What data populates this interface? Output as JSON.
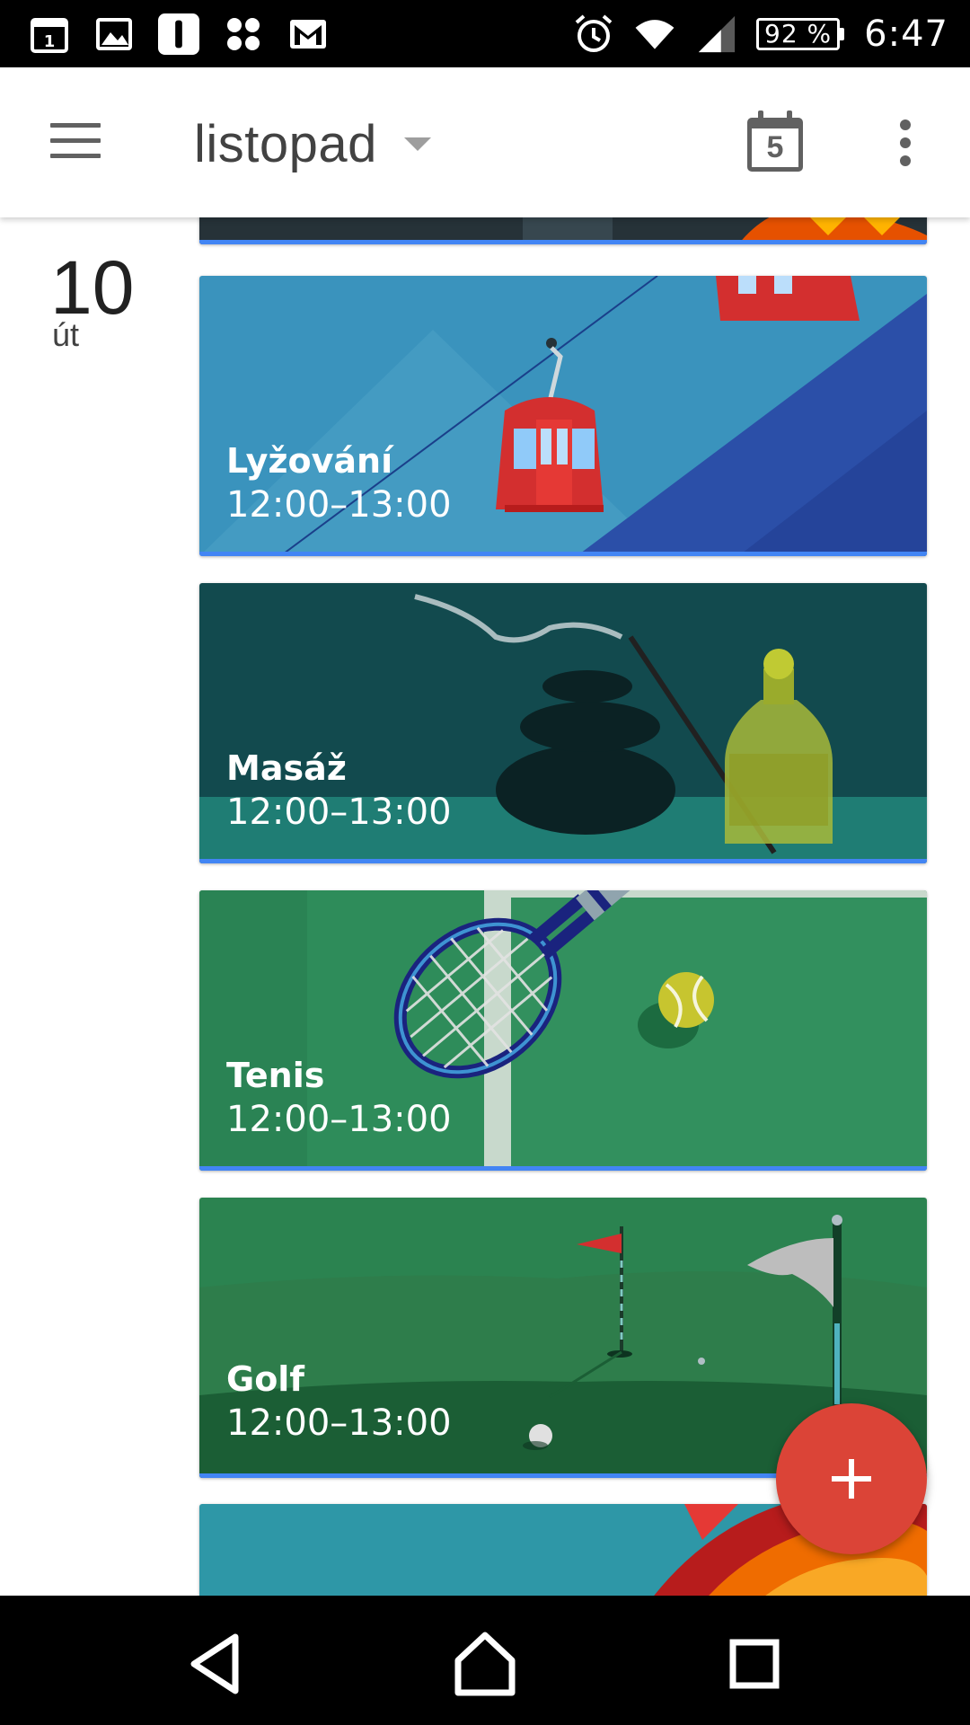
{
  "status_bar": {
    "left_icons": [
      "calendar-notification-icon",
      "gallery-icon",
      "info-icon",
      "pinwheel-icon",
      "gmail-icon"
    ],
    "right_icons": [
      "alarm-icon",
      "wifi-icon",
      "signal-icon"
    ],
    "battery": "92 %",
    "time": "6:47"
  },
  "app_bar": {
    "menu_icon": "hamburger-menu-icon",
    "month": "listopad",
    "dropdown_icon": "dropdown-caret-icon",
    "today_icon": "calendar-today-icon",
    "today_number": "5",
    "overflow_icon": "more-vert-icon"
  },
  "day": {
    "number": "10",
    "weekday": "út"
  },
  "events": [
    {
      "title": "Lyžování",
      "time": "12:00–13:00",
      "illustration": "cable-car"
    },
    {
      "title": "Masáž",
      "time": "12:00–13:00",
      "illustration": "spa-stones"
    },
    {
      "title": "Tenis",
      "time": "12:00–13:00",
      "illustration": "tennis-racket"
    },
    {
      "title": "Golf",
      "time": "12:00–13:00",
      "illustration": "golf-flag"
    }
  ],
  "fab": {
    "icon": "add-icon",
    "label": "+"
  },
  "colors": {
    "accent": "#4285f4",
    "fab": "#db4437",
    "ski_bg": "#3a93bd",
    "massage_bg": "#124a4e",
    "tennis_bg": "#2e8c5a",
    "golf_bg": "#2b8350"
  },
  "nav_bar": {
    "icons": [
      "back-icon",
      "home-icon",
      "recents-icon"
    ]
  }
}
